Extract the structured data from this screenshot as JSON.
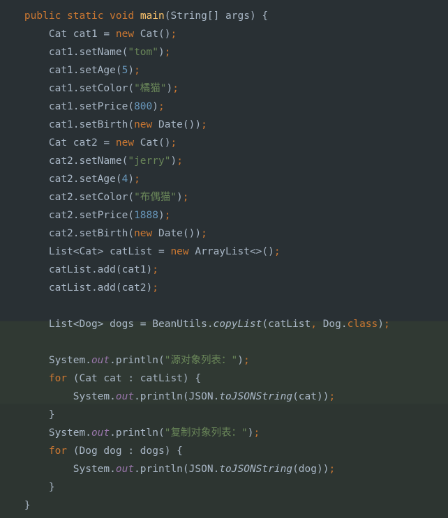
{
  "keywords": {
    "public": "public",
    "static": "static",
    "void": "void",
    "new": "new",
    "for": "for",
    "class": "class"
  },
  "code": {
    "main": "main",
    "sig_args": "(String[] args) {",
    "l1a": "Cat cat1 = ",
    "l1b": " Cat()",
    "sc": ";",
    "l2a": "cat1.setName(",
    "l2s": "\"tom\"",
    "l2b": ")",
    "l3a": "cat1.setAge(",
    "l3n": "5",
    "l3b": ")",
    "l4a": "cat1.setColor(",
    "l4s": "\"橘猫\"",
    "l4b": ")",
    "l5a": "cat1.setPrice(",
    "l5n": "800",
    "l5b": ")",
    "l6a": "cat1.setBirth(",
    "l6b": " Date())",
    "l7a": "Cat cat2 = ",
    "l7b": " Cat()",
    "l8a": "cat2.setName(",
    "l8s": "\"jerry\"",
    "l8b": ")",
    "l9a": "cat2.setAge(",
    "l9n": "4",
    "l9b": ")",
    "l10a": "cat2.setColor(",
    "l10s": "\"布偶猫\"",
    "l10b": ")",
    "l11a": "cat2.setPrice(",
    "l11n": "1888",
    "l11b": ")",
    "l12a": "cat2.setBirth(",
    "l12b": " Date())",
    "l13a": "List<Cat> catList = ",
    "l13b": " ArrayList<>()",
    "l14": "catList.add(cat1)",
    "l15": "catList.add(cat2)",
    "l16a": "List<Dog> dogs = BeanUtils.",
    "l16m": "copyList",
    "l16b": "(catList",
    "l16c": " Dog.",
    "l16d": ")",
    "comma": ",",
    "l17a": "System.",
    "l17out": "out",
    "l17b": ".println(",
    "l17s": "\"源对象列表：\"",
    "l17c": ")",
    "l18a": " (Cat cat : catList) {",
    "l19a": "System.",
    "l19out": "out",
    "l19b": ".println(JSON.",
    "l19m": "toJSONString",
    "l19c": "(cat))",
    "rbrace": "}",
    "l20a": "System.",
    "l20out": "out",
    "l20b": ".println(",
    "l20s": "\"复制对象列表：\"",
    "l20c": ")",
    "l21a": " (Dog dog : dogs) {",
    "l22a": "System.",
    "l22out": "out",
    "l22b": ".println(JSON.",
    "l22m": "toJSONString",
    "l22c": "(dog))"
  }
}
